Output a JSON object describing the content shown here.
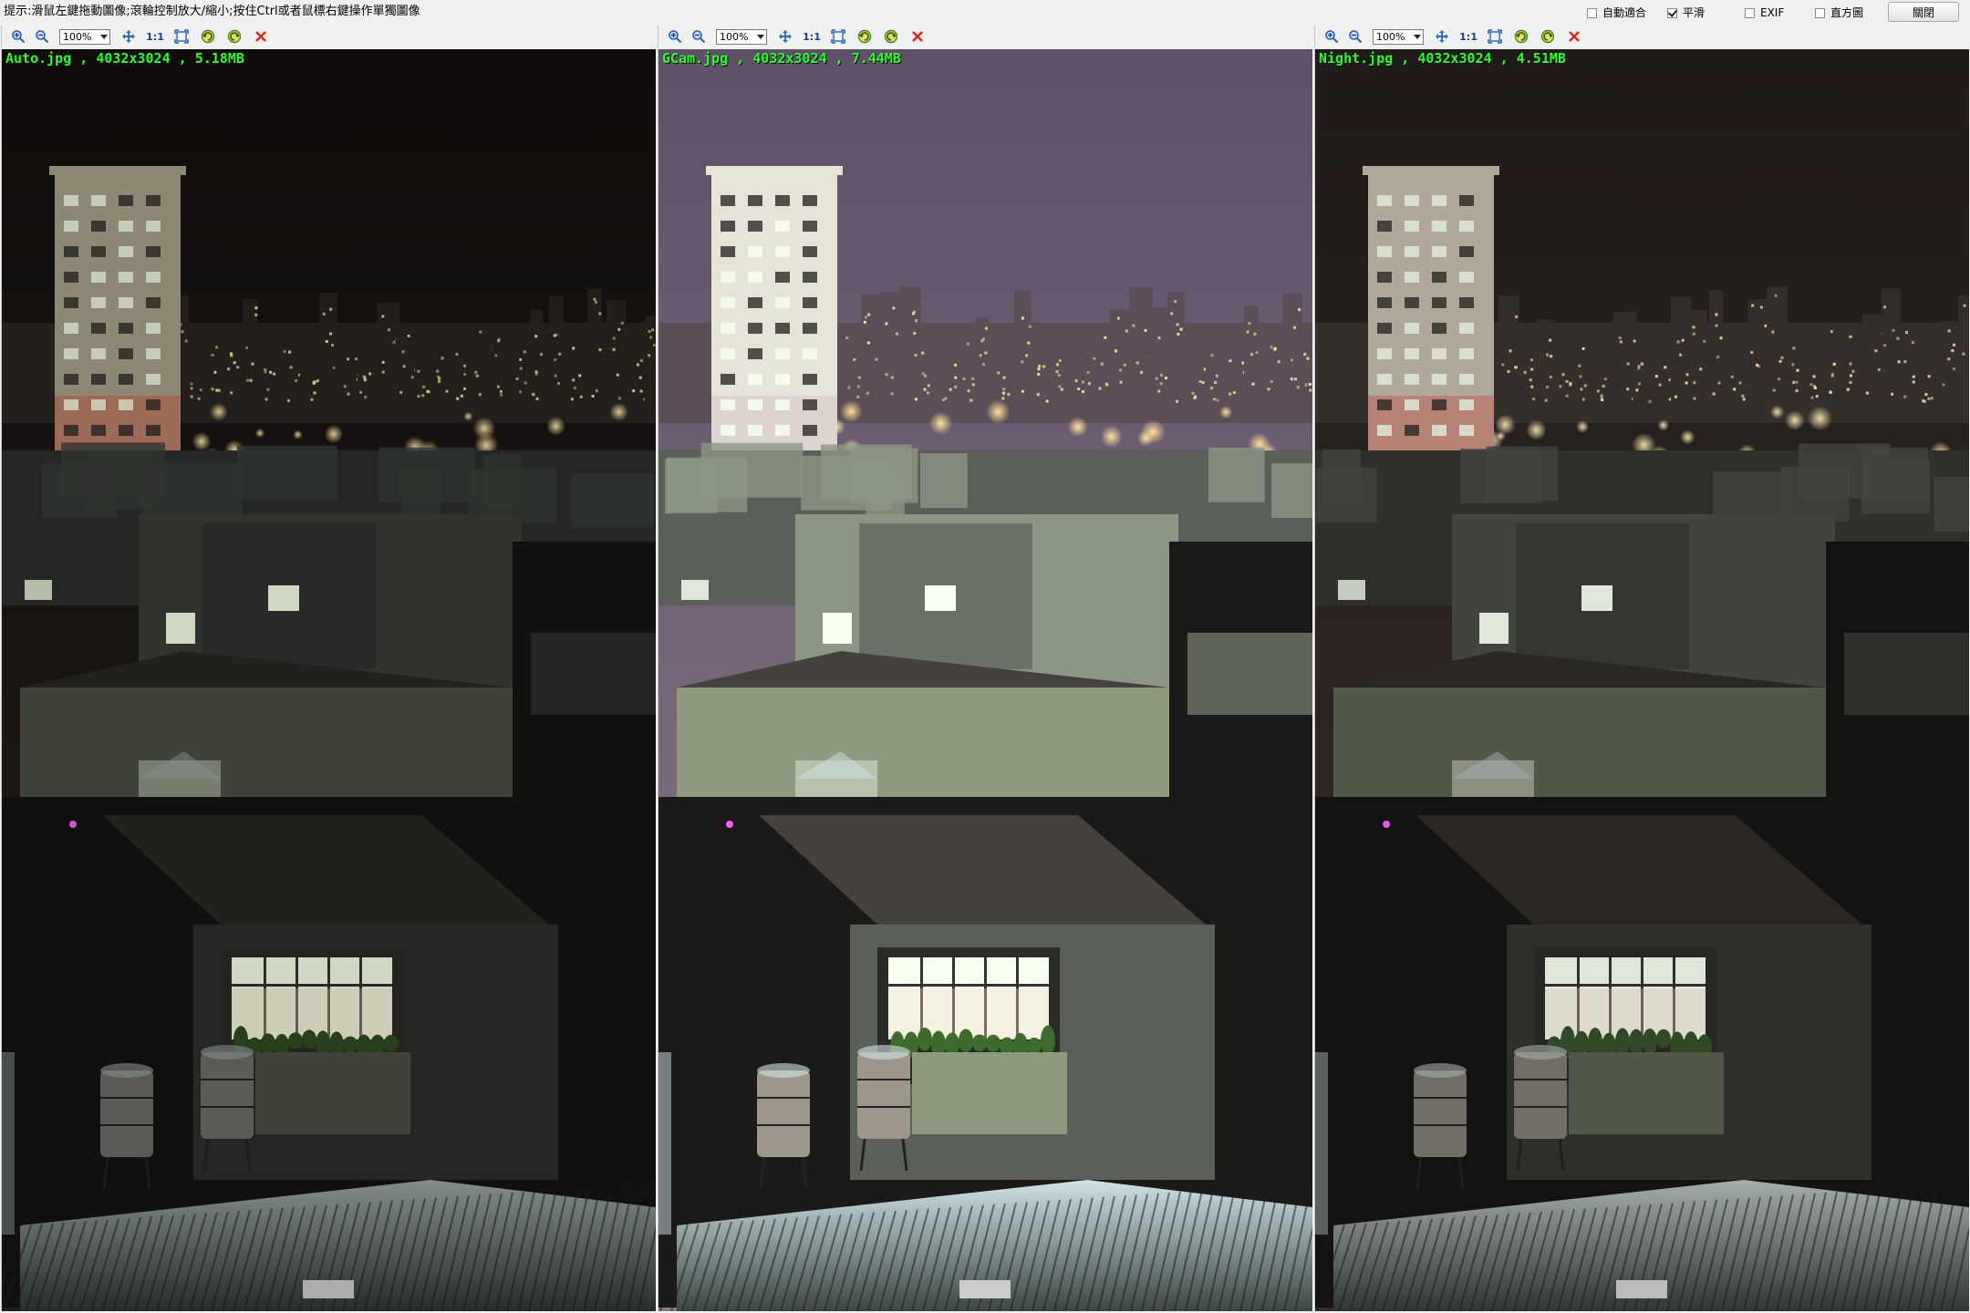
{
  "hint": "提示:滑鼠左鍵拖動圖像;滾輪控制放大/縮小;按住Ctrl或者鼠標右鍵操作單獨圖像",
  "options": [
    {
      "label": "自動適合",
      "checked": false
    },
    {
      "label": "平滑",
      "checked": true
    },
    {
      "label": "EXIF",
      "checked": false
    },
    {
      "label": "直方圖",
      "checked": false
    }
  ],
  "close_label": "關閉",
  "panes": [
    {
      "zoom": "100%",
      "one_to_one": "1:1",
      "caption": "Auto.jpg , 4032x3024 , 5.18MB"
    },
    {
      "zoom": "100%",
      "one_to_one": "1:1",
      "caption": "GCam.jpg , 4032x3024 , 7.44MB"
    },
    {
      "zoom": "100%",
      "one_to_one": "1:1",
      "caption": "Night.jpg , 4032x3024 , 4.51MB"
    }
  ],
  "colors": {
    "caption": "#2bff2b",
    "close_icon": "#e02020",
    "sky_auto": "#1b1614",
    "sky_gcam": "#6a5a72",
    "sky_night": "#2a2422"
  },
  "icons": [
    "zoom-in-icon",
    "zoom-out-icon",
    "pan-icon",
    "fit-window-icon",
    "rotate-left-icon",
    "rotate-right-icon",
    "close-icon"
  ]
}
